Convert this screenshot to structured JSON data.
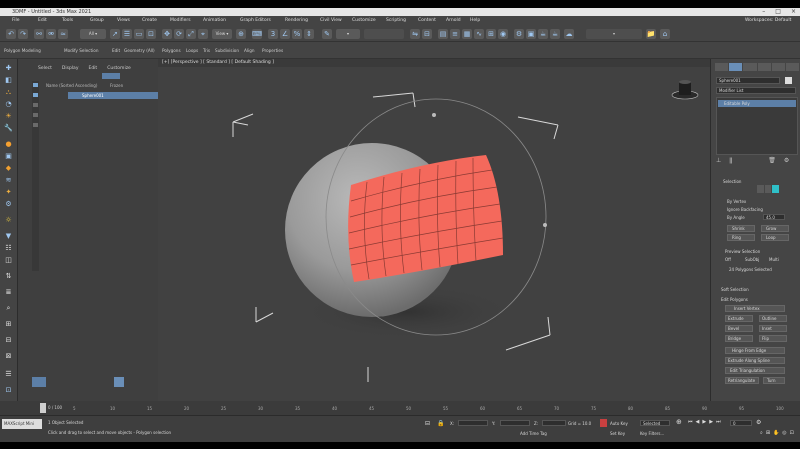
{
  "window": {
    "title": "3DMF  -  Untitled - 3ds Max 2021"
  },
  "menubar": {
    "items": [
      "File",
      "Edit",
      "Tools",
      "Group",
      "Views",
      "Create",
      "Modifiers",
      "Animation",
      "Graph Editors",
      "Rendering",
      "Civil View",
      "Customize",
      "Scripting",
      "Content",
      "Arnold",
      "Help"
    ],
    "workspace_label": "Workspaces: Default"
  },
  "ribbon": {
    "items": [
      "Polygon Modeling",
      "Modify Selection",
      "Edit",
      "Geometry (All)",
      "Polygons",
      "Loops",
      "Tris",
      "Subdivision",
      "Align",
      "Properties"
    ]
  },
  "explorer": {
    "tabs": [
      "Select",
      "Display",
      "Edit",
      "Customize"
    ],
    "header": "Name (Sorted Ascending)",
    "frozen_header": "Frozen",
    "selected_item": "Sphere001"
  },
  "viewport": {
    "label": "[+] [Perspective ] [ Standard ] [ Default Shading ]"
  },
  "command_panel": {
    "object_name": "Sphere001",
    "modifier_list": "Modifier List",
    "stack_item": "Editable Poly",
    "section_selection": "Selection",
    "by_vertex": "By Vertex",
    "ignore_backfacing": "Ignore Backfacing",
    "by_angle": "By Angle",
    "angle_value": "45.0",
    "shrink_label": "Shrink",
    "grow_label": "Grow",
    "ring_label": "Ring",
    "loop_label": "Loop",
    "preview_selection": "Preview Selection",
    "preview_off": "Off",
    "preview_subobj": "SubObj",
    "preview_multi": "Multi",
    "faces_selected": "24 Polygons Selected",
    "soft_selection": "Soft Selection",
    "edit_polygons": "Edit Polygons",
    "insert_vertex": "Insert Vertex",
    "extrude": "Extrude",
    "outline": "Outline",
    "bevel": "Bevel",
    "inset": "Inset",
    "bridge": "Bridge",
    "flip": "Flip",
    "hinge_from_edge": "Hinge From Edge",
    "extrude_along_spline": "Extrude Along Spline",
    "edit_triangulation": "Edit Triangulation",
    "retriangulate": "Retriangulate",
    "turn": "Turn"
  },
  "timeline": {
    "frame_display": "0 / 100",
    "ticks": [
      "0",
      "5",
      "10",
      "15",
      "20",
      "25",
      "30",
      "35",
      "40",
      "45",
      "50",
      "55",
      "60",
      "65",
      "70",
      "75",
      "80",
      "85",
      "90",
      "95",
      "100"
    ]
  },
  "status": {
    "maxscript": "MAXScript Mini",
    "prompt_selected": "1 Object Selected",
    "prompt_hint": "Click and drag to select and move objects - Polygon selection",
    "x_label": "X:",
    "y_label": "Y:",
    "z_label": "Z:",
    "grid": "Grid = 10.0",
    "add_time_tag": "Add Time Tag",
    "auto_key": "Auto Key",
    "set_key": "Set Key",
    "selected_label": "Selected",
    "key_filters": "Key Filters...",
    "frame_value": "0"
  },
  "colors": {
    "panel_bg": "#444444",
    "viewport_bg": "#414141",
    "sphere": "#9a9a9a",
    "selection_red": "#f4695c",
    "accent_blue": "#5c7fa7",
    "cyan_button": "#2fc0c8"
  }
}
